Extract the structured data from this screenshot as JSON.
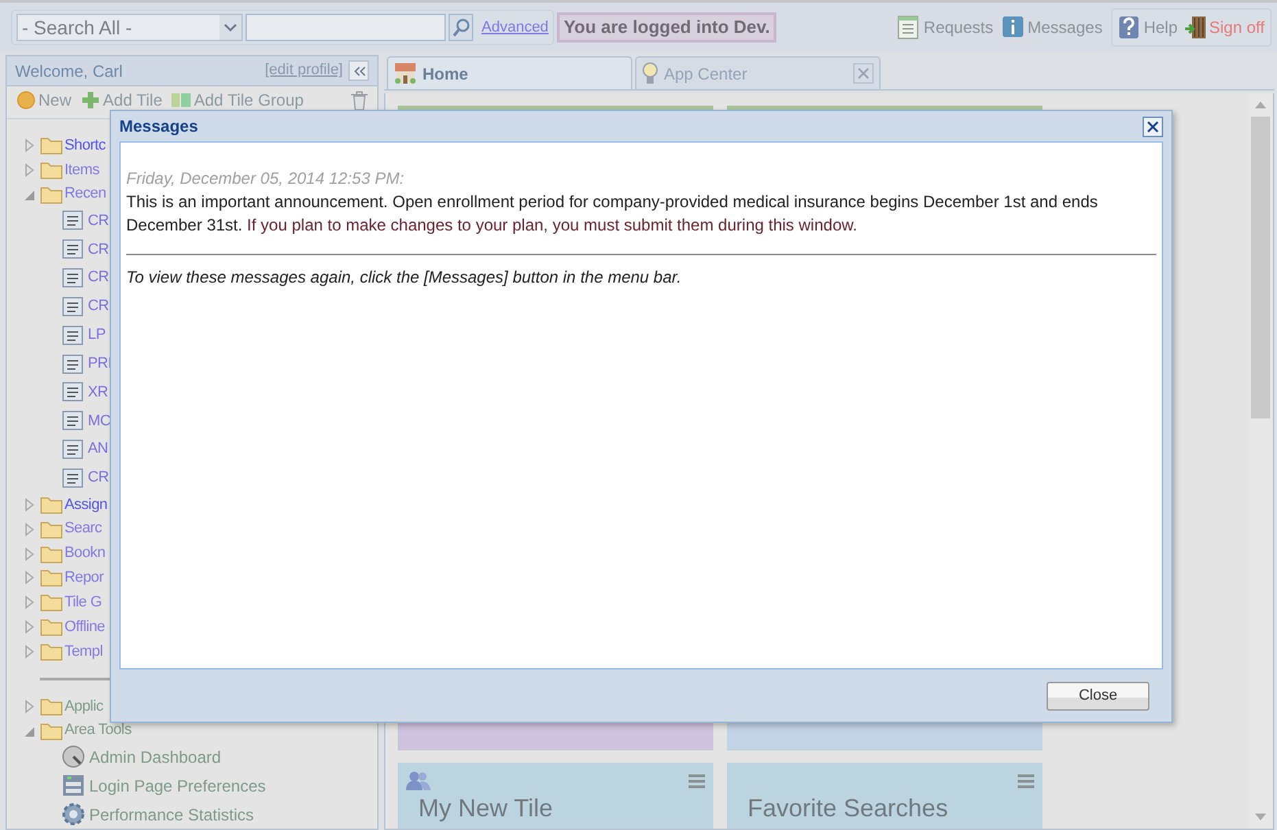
{
  "search_bar": {
    "scope": "- Search All -",
    "advanced_link": "Advanced",
    "login_notice": "You are logged into Dev."
  },
  "menu": [
    {
      "label": "Requests",
      "kind": "requests"
    },
    {
      "label": "Messages",
      "kind": "messages"
    }
  ],
  "user_menu": [
    {
      "label": "Help",
      "kind": "help"
    },
    {
      "label": "Sign off",
      "kind": "signoff"
    }
  ],
  "sidebar": {
    "welcome": "Welcome, Carl",
    "edit_profile": "[edit profile]",
    "toolbar": [
      {
        "label": "New",
        "kind": "new"
      },
      {
        "label": "Add Tile",
        "kind": "add"
      },
      {
        "label": "Add Tile Group",
        "kind": "group"
      }
    ],
    "tree": [
      {
        "label": "Shortc",
        "kind": "folder",
        "expanded": false,
        "strong": true
      },
      {
        "label": "Items",
        "kind": "folder",
        "expanded": false,
        "strong": false
      },
      {
        "label": "Recen",
        "kind": "folder",
        "expanded": true,
        "strong": false,
        "children": [
          {
            "label": "CR",
            "kind": "item"
          },
          {
            "label": "CR",
            "kind": "item"
          },
          {
            "label": "CR",
            "kind": "item"
          },
          {
            "label": "CR",
            "kind": "item"
          },
          {
            "label": "LP",
            "kind": "item"
          },
          {
            "label": "PRI",
            "kind": "item"
          },
          {
            "label": "XR",
            "kind": "item"
          },
          {
            "label": "MC",
            "kind": "item"
          },
          {
            "label": "AN",
            "kind": "item"
          },
          {
            "label": "CR",
            "kind": "item"
          }
        ]
      },
      {
        "label": "Assign",
        "kind": "folder",
        "expanded": false,
        "strong": true
      },
      {
        "label": "Searc",
        "kind": "folder",
        "expanded": false,
        "strong": false
      },
      {
        "label": "Bookn",
        "kind": "folder",
        "expanded": false,
        "strong": false
      },
      {
        "label": "Repor",
        "kind": "folder",
        "expanded": false,
        "strong": false
      },
      {
        "label": "Tile G",
        "kind": "folder",
        "expanded": false,
        "strong": false
      },
      {
        "label": "Offline",
        "kind": "folder",
        "expanded": false,
        "strong": false
      },
      {
        "label": "Templ",
        "kind": "folder",
        "expanded": false,
        "strong": false
      }
    ],
    "tools": [
      {
        "label": "Applic",
        "kind": "folder",
        "expanded": false
      },
      {
        "label": "Area Tools",
        "kind": "folder",
        "expanded": true,
        "children": [
          {
            "label": "Admin Dashboard",
            "kind": "dashboard"
          },
          {
            "label": "Login Page Preferences",
            "kind": "preferences"
          },
          {
            "label": "Performance Statistics",
            "kind": "statistics"
          }
        ]
      }
    ]
  },
  "tabs": [
    {
      "label": "Home",
      "kind": "home",
      "selected": true,
      "closable": false
    },
    {
      "label": "App Center",
      "kind": "bulb",
      "selected": false,
      "closable": true
    }
  ],
  "tiles": [
    {
      "color": "#cec3df"
    },
    {
      "color": "#c3d3e6"
    },
    {
      "color": "#bcd4e0",
      "title": "My New Tile",
      "kind": "people"
    },
    {
      "color": "#bcd4e0",
      "title": "Favorite Searches"
    }
  ],
  "dialog": {
    "title": "Messages",
    "date": "Friday, December 05, 2014 12:53 PM:",
    "body": [
      {
        "text": "This is an important announcement. Open enrollment period for company-provided medical insurance begins December 1st and ends December 31st.",
        "kind": "plain"
      },
      {
        "text": "If you plan to make changes to your plan, you must submit them during this window.",
        "kind": "highlight"
      }
    ],
    "footer_note": "To view these messages again, click the [Messages] button in the menu bar.",
    "button": "Close"
  }
}
